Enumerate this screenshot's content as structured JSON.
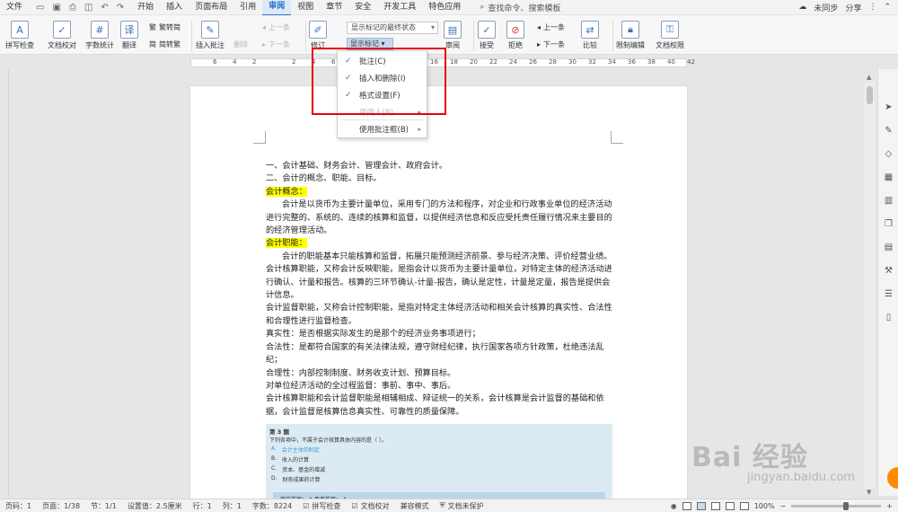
{
  "menubar": {
    "file": "文件",
    "tabs": [
      "开始",
      "插入",
      "页面布局",
      "引用",
      "审阅",
      "视图",
      "章节",
      "安全",
      "开发工具",
      "特色应用"
    ],
    "active_tab": "审阅",
    "search": "查找命令、搜索模板",
    "sync": "未同步",
    "share": "分享"
  },
  "ribbon": {
    "spell_check": "拼写检查",
    "doc_proof": "文档校对",
    "word_count": "字数统计",
    "translate": "翻译",
    "trad_to_simp": "繁转简",
    "simp_to_trad": "简转繁",
    "insert_comment": "插入批注",
    "delete": "删除",
    "prev": "上一条",
    "next": "下一条",
    "revise": "修订",
    "display_select": "显示标记的最终状态",
    "show_markup": "显示标记",
    "review": "审阅",
    "accept": "接受",
    "reject": "拒绝",
    "prev2": "上一条",
    "next2": "下一条",
    "compare": "比较",
    "restrict_edit": "限制编辑",
    "doc_rights": "文档权限"
  },
  "ruler": {
    "marks": [
      "6",
      "4",
      "2",
      "",
      "2",
      "4",
      "6",
      "8",
      "10",
      "12",
      "14",
      "16",
      "18",
      "20",
      "22",
      "24",
      "26",
      "28",
      "30",
      "32",
      "34",
      "36",
      "38",
      "40",
      "42"
    ]
  },
  "dropdown": {
    "items": [
      {
        "label": "批注(C)",
        "checked": true,
        "disabled": false
      },
      {
        "label": "插入和删除(I)",
        "checked": true,
        "disabled": false
      },
      {
        "label": "格式设置(F)",
        "checked": true,
        "disabled": false
      },
      {
        "label": "审阅人(R)",
        "checked": false,
        "disabled": true
      },
      {
        "label": "使用批注框(B)",
        "checked": false,
        "disabled": false
      }
    ]
  },
  "document": {
    "line1": "一、会计基础、财务会计、管理会计、政府会计。",
    "line2": "二、会计的概念、职能、目标。",
    "h_concept": "会计概念：",
    "concept": "会计是以货币为主要计量单位，采用专门的方法和程序，对企业和行政事业单位的经济活动进行完整的、系统的、连续的核算和监督，以提供经济信息和反应受托责任履行情况来主要目的的经济管理活动。",
    "h_function": "会计职能：",
    "function": "会计的职能基本只能核算和监督，拓展只能预测经济前景、参与经济决策、评价经营业绩。",
    "p_core": "会计核算职能，又称会计反映职能，是指会计以货币为主要计量单位，对特定主体的经济活动进行确认、计量和报告。核算的三环节确认-计量-报告，确认是定性，计量是定量，报告是提供会计信息。",
    "p_supervise": "会计监督职能，又称会计控制职能，是指对特定主体经济活动和相关会计核算的真实性、合法性和合理性进行监督检查。",
    "p_true": "真实性：是否根据实际发生的是那个的经济业务事项进行；",
    "p_legal": "合法性：是都符合国家的有关法律法规，遵守财经纪律，执行国家各项方针政策，杜绝违法乱纪；",
    "p_reason": "合理性：内部控制制度、财务收支计划、预算目标。",
    "p_all": "对单位经济活动的全过程监督：事前、事中、事后。",
    "p_relation": "会计核算职能和会计监督职能是相辅相成、辩证统一的关系，会计核算是会计监督的基础和依据，会计监督是核算信息真实性、可靠性的质量保障。",
    "quiz": {
      "title": "第 3 题",
      "question": "下列各项中，不属于会计核算具体内容的是（    ）。",
      "options": [
        {
          "key": "A.",
          "text": "会计主体的制定"
        },
        {
          "key": "B.",
          "text": "收入的计算"
        },
        {
          "key": "C.",
          "text": "资本、基金的增减"
        },
        {
          "key": "D.",
          "text": "财务成果的计算"
        }
      ],
      "answer_bar": "我的答案：  A      参考答案：  A"
    }
  },
  "status": {
    "page_num": "页码：1",
    "pages": "页面：1/38",
    "section": "节：1/1",
    "setting": "设置值：2.5厘米",
    "row": "行：1",
    "col": "列：1",
    "words": "字数：8224",
    "spell": "拼写检查",
    "proof": "文档校对",
    "compat": "兼容模式",
    "protect": "文档未保护",
    "zoom": "100%",
    "zoom_fraction": 0.58
  },
  "watermark": {
    "main": "Bai 经验",
    "sub": "jingyan.baidu.com"
  }
}
